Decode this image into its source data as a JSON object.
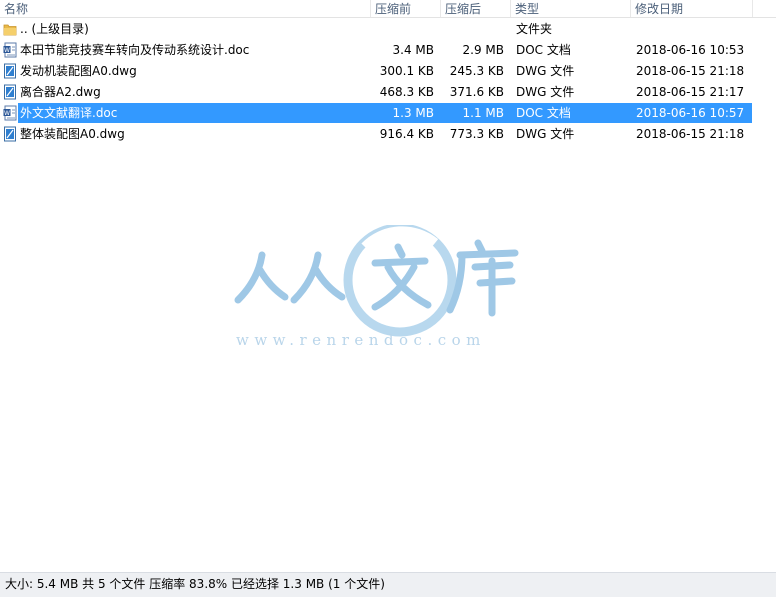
{
  "columns": {
    "name": "名称",
    "size": "压缩前",
    "compressed": "压缩后",
    "type": "类型",
    "modified": "修改日期"
  },
  "rows": [
    {
      "name": ".. (上级目录)",
      "size": "",
      "compressed": "",
      "type": "文件夹",
      "modified": "",
      "icon": "folder-icon"
    },
    {
      "name": "本田节能竞技赛车转向及传动系统设计.doc",
      "size": "3.4 MB",
      "compressed": "2.9 MB",
      "type": "DOC 文档",
      "modified": "2018-06-16 10:53",
      "icon": "doc-file-icon"
    },
    {
      "name": "发动机装配图A0.dwg",
      "size": "300.1 KB",
      "compressed": "245.3 KB",
      "type": "DWG 文件",
      "modified": "2018-06-15 21:18",
      "icon": "dwg-file-icon"
    },
    {
      "name": "离合器A2.dwg",
      "size": "468.3 KB",
      "compressed": "371.6 KB",
      "type": "DWG 文件",
      "modified": "2018-06-15 21:17",
      "icon": "dwg-file-icon"
    },
    {
      "name": "外文文献翻译.doc",
      "size": "1.3 MB",
      "compressed": "1.1 MB",
      "type": "DOC 文档",
      "modified": "2018-06-16 10:57",
      "icon": "doc-file-icon",
      "selected": true
    },
    {
      "name": "整体装配图A0.dwg",
      "size": "916.4 KB",
      "compressed": "773.3 KB",
      "type": "DWG 文件",
      "modified": "2018-06-15 21:18",
      "icon": "dwg-file-icon"
    }
  ],
  "status": "大小: 5.4 MB 共 5 个文件 压缩率 83.8% 已经选择 1.3 MB (1 个文件)",
  "watermark": {
    "text": "人人文库",
    "url": "www.renrendoc.com",
    "color": "#a9cde8"
  },
  "colors": {
    "selection": "#3399ff",
    "header_text": "#4c607a",
    "statusbar_bg": "#eef0f3"
  }
}
